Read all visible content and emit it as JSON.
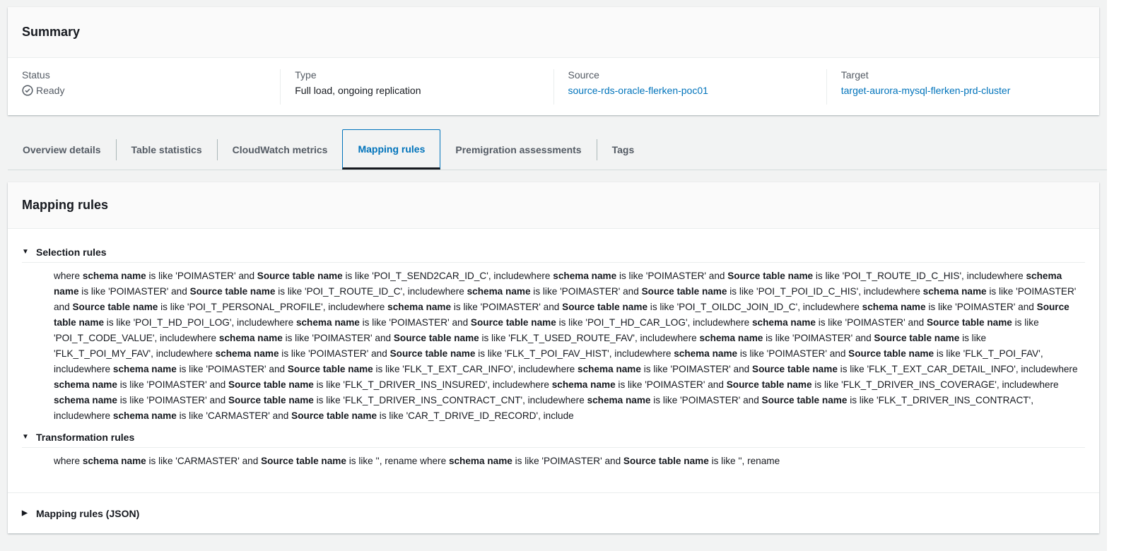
{
  "summary": {
    "title": "Summary",
    "status_label": "Status",
    "status_value": "Ready",
    "type_label": "Type",
    "type_value": "Full load, ongoing replication",
    "source_label": "Source",
    "source_value": "source-rds-oracle-flerken-poc01",
    "target_label": "Target",
    "target_value": "target-aurora-mysql-flerken-prd-cluster"
  },
  "tabs": [
    "Overview details",
    "Table statistics",
    "CloudWatch metrics",
    "Mapping rules",
    "Premigration assessments",
    "Tags"
  ],
  "active_tab": "Mapping rules",
  "mapping": {
    "title": "Mapping rules",
    "selection_title": "Selection rules",
    "transformation_title": "Transformation rules",
    "json_title": "Mapping rules (JSON)",
    "words": {
      "where": "where ",
      "schema": "schema name",
      "is_like": " is like ",
      "and": " and ",
      "source": "Source table name",
      "include": ", include",
      "rename": ", rename "
    },
    "selection_rules": [
      {
        "schema": "'POIMASTER'",
        "table": "'POI_T_SEND2CAR_ID_C'"
      },
      {
        "schema": "'POIMASTER'",
        "table": "'POI_T_ROUTE_ID_C_HIS'"
      },
      {
        "schema": "'POIMASTER'",
        "table": "'POI_T_ROUTE_ID_C'"
      },
      {
        "schema": "'POIMASTER'",
        "table": "'POI_T_POI_ID_C_HIS'"
      },
      {
        "schema": "'POIMASTER'",
        "table": "'POI_T_PERSONAL_PROFILE'"
      },
      {
        "schema": "'POIMASTER'",
        "table": "'POI_T_OILDC_JOIN_ID_C'"
      },
      {
        "schema": "'POIMASTER'",
        "table": "'POI_T_HD_POI_LOG'"
      },
      {
        "schema": "'POIMASTER'",
        "table": "'POI_T_HD_CAR_LOG'"
      },
      {
        "schema": "'POIMASTER'",
        "table": "'POI_T_CODE_VALUE'"
      },
      {
        "schema": "'POIMASTER'",
        "table": "'FLK_T_USED_ROUTE_FAV'"
      },
      {
        "schema": "'POIMASTER'",
        "table": "'FLK_T_POI_MY_FAV'"
      },
      {
        "schema": "'POIMASTER'",
        "table": "'FLK_T_POI_FAV_HIST'"
      },
      {
        "schema": "'POIMASTER'",
        "table": "'FLK_T_POI_FAV'"
      },
      {
        "schema": "'POIMASTER'",
        "table": "'FLK_T_EXT_CAR_INFO'"
      },
      {
        "schema": "'POIMASTER'",
        "table": "'FLK_T_EXT_CAR_DETAIL_INFO'"
      },
      {
        "schema": "'POIMASTER'",
        "table": "'FLK_T_DRIVER_INS_INSURED'"
      },
      {
        "schema": "'POIMASTER'",
        "table": "'FLK_T_DRIVER_INS_COVERAGE'"
      },
      {
        "schema": "'POIMASTER'",
        "table": "'FLK_T_DRIVER_INS_CONTRACT_CNT'"
      },
      {
        "schema": "'POIMASTER'",
        "table": "'FLK_T_DRIVER_INS_CONTRACT'"
      },
      {
        "schema": "'CARMASTER'",
        "table": "'CAR_T_DRIVE_ID_RECORD'"
      }
    ],
    "transformation_rules": [
      {
        "schema": "'CARMASTER'",
        "table": "''"
      },
      {
        "schema": "'POIMASTER'",
        "table": "''"
      }
    ]
  }
}
